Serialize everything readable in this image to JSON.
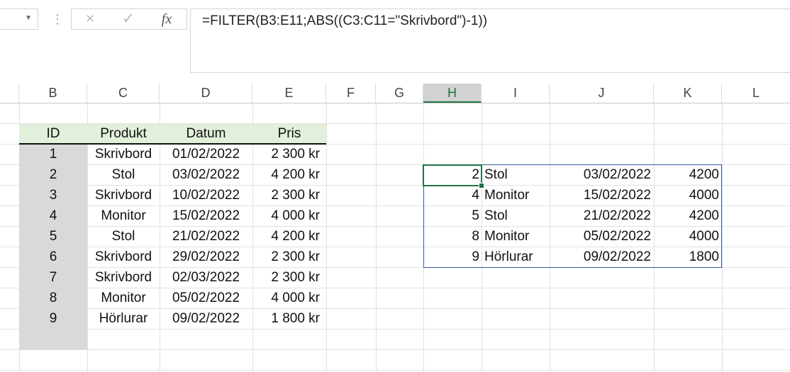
{
  "formula_bar": {
    "name_box_value": "",
    "cancel_icon": "×",
    "enter_icon": "✓",
    "fx_label": "fx",
    "formula": "=FILTER(B3:E11;ABS((C3:C11=\"Skrivbord\")-1))"
  },
  "columns": [
    "B",
    "C",
    "D",
    "E",
    "F",
    "G",
    "H",
    "I",
    "J",
    "K",
    "L"
  ],
  "source_table": {
    "headers": [
      "ID",
      "Produkt",
      "Datum",
      "Pris"
    ],
    "rows": [
      [
        "1",
        "Skrivbord",
        "01/02/2022",
        "2 300 kr"
      ],
      [
        "2",
        "Stol",
        "03/02/2022",
        "4 200 kr"
      ],
      [
        "3",
        "Skrivbord",
        "10/02/2022",
        "2 300 kr"
      ],
      [
        "4",
        "Monitor",
        "15/02/2022",
        "4 000 kr"
      ],
      [
        "5",
        "Stol",
        "21/02/2022",
        "4 200 kr"
      ],
      [
        "6",
        "Skrivbord",
        "29/02/2022",
        "2 300 kr"
      ],
      [
        "7",
        "Skrivbord",
        "02/03/2022",
        "2 300 kr"
      ],
      [
        "8",
        "Monitor",
        "05/02/2022",
        "4 000 kr"
      ],
      [
        "9",
        "Hörlurar",
        "09/02/2022",
        "1 800 kr"
      ]
    ]
  },
  "result_table": {
    "rows": [
      [
        "2",
        "Stol",
        "03/02/2022",
        "4200"
      ],
      [
        "4",
        "Monitor",
        "15/02/2022",
        "4000"
      ],
      [
        "5",
        "Stol",
        "21/02/2022",
        "4200"
      ],
      [
        "8",
        "Monitor",
        "05/02/2022",
        "4000"
      ],
      [
        "9",
        "Hörlurar",
        "09/02/2022",
        "1800"
      ]
    ]
  },
  "colors": {
    "header_fill": "#e2efda",
    "id_column_fill": "#d9d9d9",
    "selection_green": "#217346",
    "spill_border": "#2f5aa0"
  }
}
